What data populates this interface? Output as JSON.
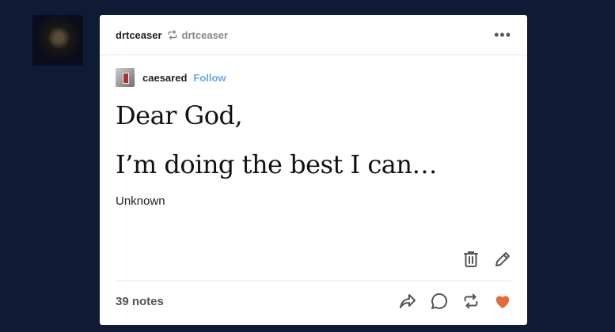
{
  "post": {
    "author": "drtceaser",
    "reblogged_from": "drtceaser",
    "menu_label": "•••",
    "reblog": {
      "name": "caesared",
      "follow_label": "Follow"
    },
    "quote_lines": [
      "Dear God,",
      "I’m doing the best I can…"
    ],
    "quote_source": "Unknown",
    "notes": "39 notes",
    "icons": [
      "delete-icon",
      "edit-icon",
      "share-icon",
      "reply-icon",
      "reblog-icon",
      "like-icon"
    ],
    "colors": {
      "background": "#0f1a35",
      "follow": "#6aa9e0",
      "like": "#e46a3b"
    }
  }
}
